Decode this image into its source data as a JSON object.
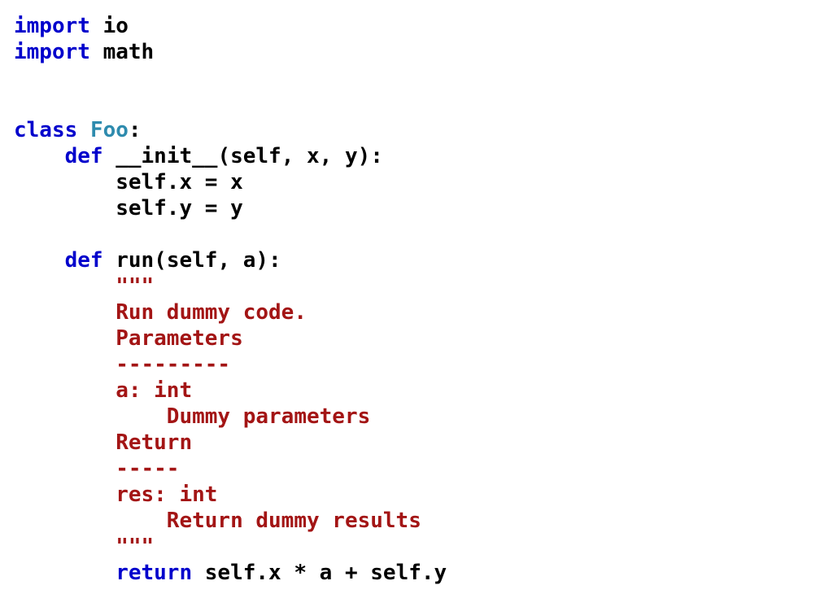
{
  "theme": {
    "text": "#000000",
    "keyword": "#0000cc",
    "classname": "#2e8bae",
    "string": "#a31515",
    "background": "#ffffff"
  },
  "code_lines": [
    {
      "line": 0,
      "indent": 0,
      "tokens": [
        {
          "t": "import",
          "k": "keyword"
        },
        {
          "t": " io",
          "k": "text"
        }
      ]
    },
    {
      "line": 1,
      "indent": 0,
      "tokens": [
        {
          "t": "import",
          "k": "keyword"
        },
        {
          "t": " math",
          "k": "text"
        }
      ]
    },
    {
      "line": 4,
      "indent": 0,
      "tokens": [
        {
          "t": "class",
          "k": "keyword"
        },
        {
          "t": " ",
          "k": "text"
        },
        {
          "t": "Foo",
          "k": "classname"
        },
        {
          "t": ":",
          "k": "text"
        }
      ]
    },
    {
      "line": 5,
      "indent": 4,
      "tokens": [
        {
          "t": "def",
          "k": "keyword"
        },
        {
          "t": " __init__(self, x, y):",
          "k": "text"
        }
      ]
    },
    {
      "line": 6,
      "indent": 8,
      "tokens": [
        {
          "t": "self.x = x",
          "k": "text"
        }
      ]
    },
    {
      "line": 7,
      "indent": 8,
      "tokens": [
        {
          "t": "self.y = y",
          "k": "text"
        }
      ]
    },
    {
      "line": 9,
      "indent": 4,
      "tokens": [
        {
          "t": "def",
          "k": "keyword"
        },
        {
          "t": " run(self, a):",
          "k": "text"
        }
      ]
    },
    {
      "line": 10,
      "indent": 8,
      "tokens": [
        {
          "t": "\"\"\"",
          "k": "string"
        }
      ]
    },
    {
      "line": 11,
      "indent": 8,
      "tokens": [
        {
          "t": "Run dummy code.",
          "k": "string"
        }
      ]
    },
    {
      "line": 12,
      "indent": 8,
      "tokens": [
        {
          "t": "Parameters",
          "k": "string"
        }
      ]
    },
    {
      "line": 13,
      "indent": 8,
      "tokens": [
        {
          "t": "---------",
          "k": "string"
        }
      ]
    },
    {
      "line": 14,
      "indent": 8,
      "tokens": [
        {
          "t": "a: int",
          "k": "string"
        }
      ]
    },
    {
      "line": 15,
      "indent": 12,
      "tokens": [
        {
          "t": "Dummy parameters",
          "k": "string"
        }
      ]
    },
    {
      "line": 16,
      "indent": 8,
      "tokens": [
        {
          "t": "Return",
          "k": "string"
        }
      ]
    },
    {
      "line": 17,
      "indent": 8,
      "tokens": [
        {
          "t": "-----",
          "k": "string"
        }
      ]
    },
    {
      "line": 18,
      "indent": 8,
      "tokens": [
        {
          "t": "res: int",
          "k": "string"
        }
      ]
    },
    {
      "line": 19,
      "indent": 12,
      "tokens": [
        {
          "t": "Return dummy results",
          "k": "string"
        }
      ]
    },
    {
      "line": 20,
      "indent": 8,
      "tokens": [
        {
          "t": "\"\"\"",
          "k": "string"
        }
      ]
    },
    {
      "line": 21,
      "indent": 8,
      "tokens": [
        {
          "t": "return",
          "k": "keyword"
        },
        {
          "t": " self.x * a + self.y",
          "k": "text"
        }
      ]
    }
  ]
}
